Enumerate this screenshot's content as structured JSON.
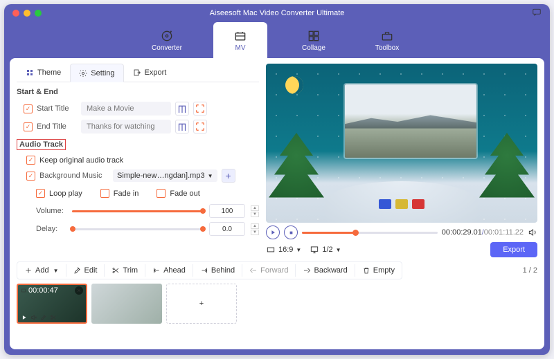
{
  "title": "Aiseesoft Mac Video Converter Ultimate",
  "nav": {
    "converter": "Converter",
    "mv": "MV",
    "collage": "Collage",
    "toolbox": "Toolbox"
  },
  "tabs": {
    "theme": "Theme",
    "setting": "Setting",
    "export": "Export"
  },
  "start_end": {
    "title": "Start & End",
    "start_label": "Start Title",
    "start_value": "Make a Movie",
    "end_label": "End Title",
    "end_value": "Thanks for watching"
  },
  "audio": {
    "title": "Audio Track",
    "keep": "Keep original audio track",
    "bgm_label": "Background Music",
    "bgm_file": "Simple-new…ngdan].mp3",
    "loop": "Loop play",
    "fadein": "Fade in",
    "fadeout": "Fade out",
    "volume_label": "Volume:",
    "volume_value": "100",
    "delay_label": "Delay:",
    "delay_value": "0.0"
  },
  "player": {
    "current": "00:00:29.01",
    "total": "00:01:11.22",
    "ratio": "16:9",
    "idx": "1/2",
    "export": "Export"
  },
  "toolbar": {
    "add": "Add",
    "edit": "Edit",
    "trim": "Trim",
    "ahead": "Ahead",
    "behind": "Behind",
    "forward": "Forward",
    "backward": "Backward",
    "empty": "Empty",
    "page": "1 / 2"
  },
  "thumb": {
    "dur": "00:00:47"
  }
}
